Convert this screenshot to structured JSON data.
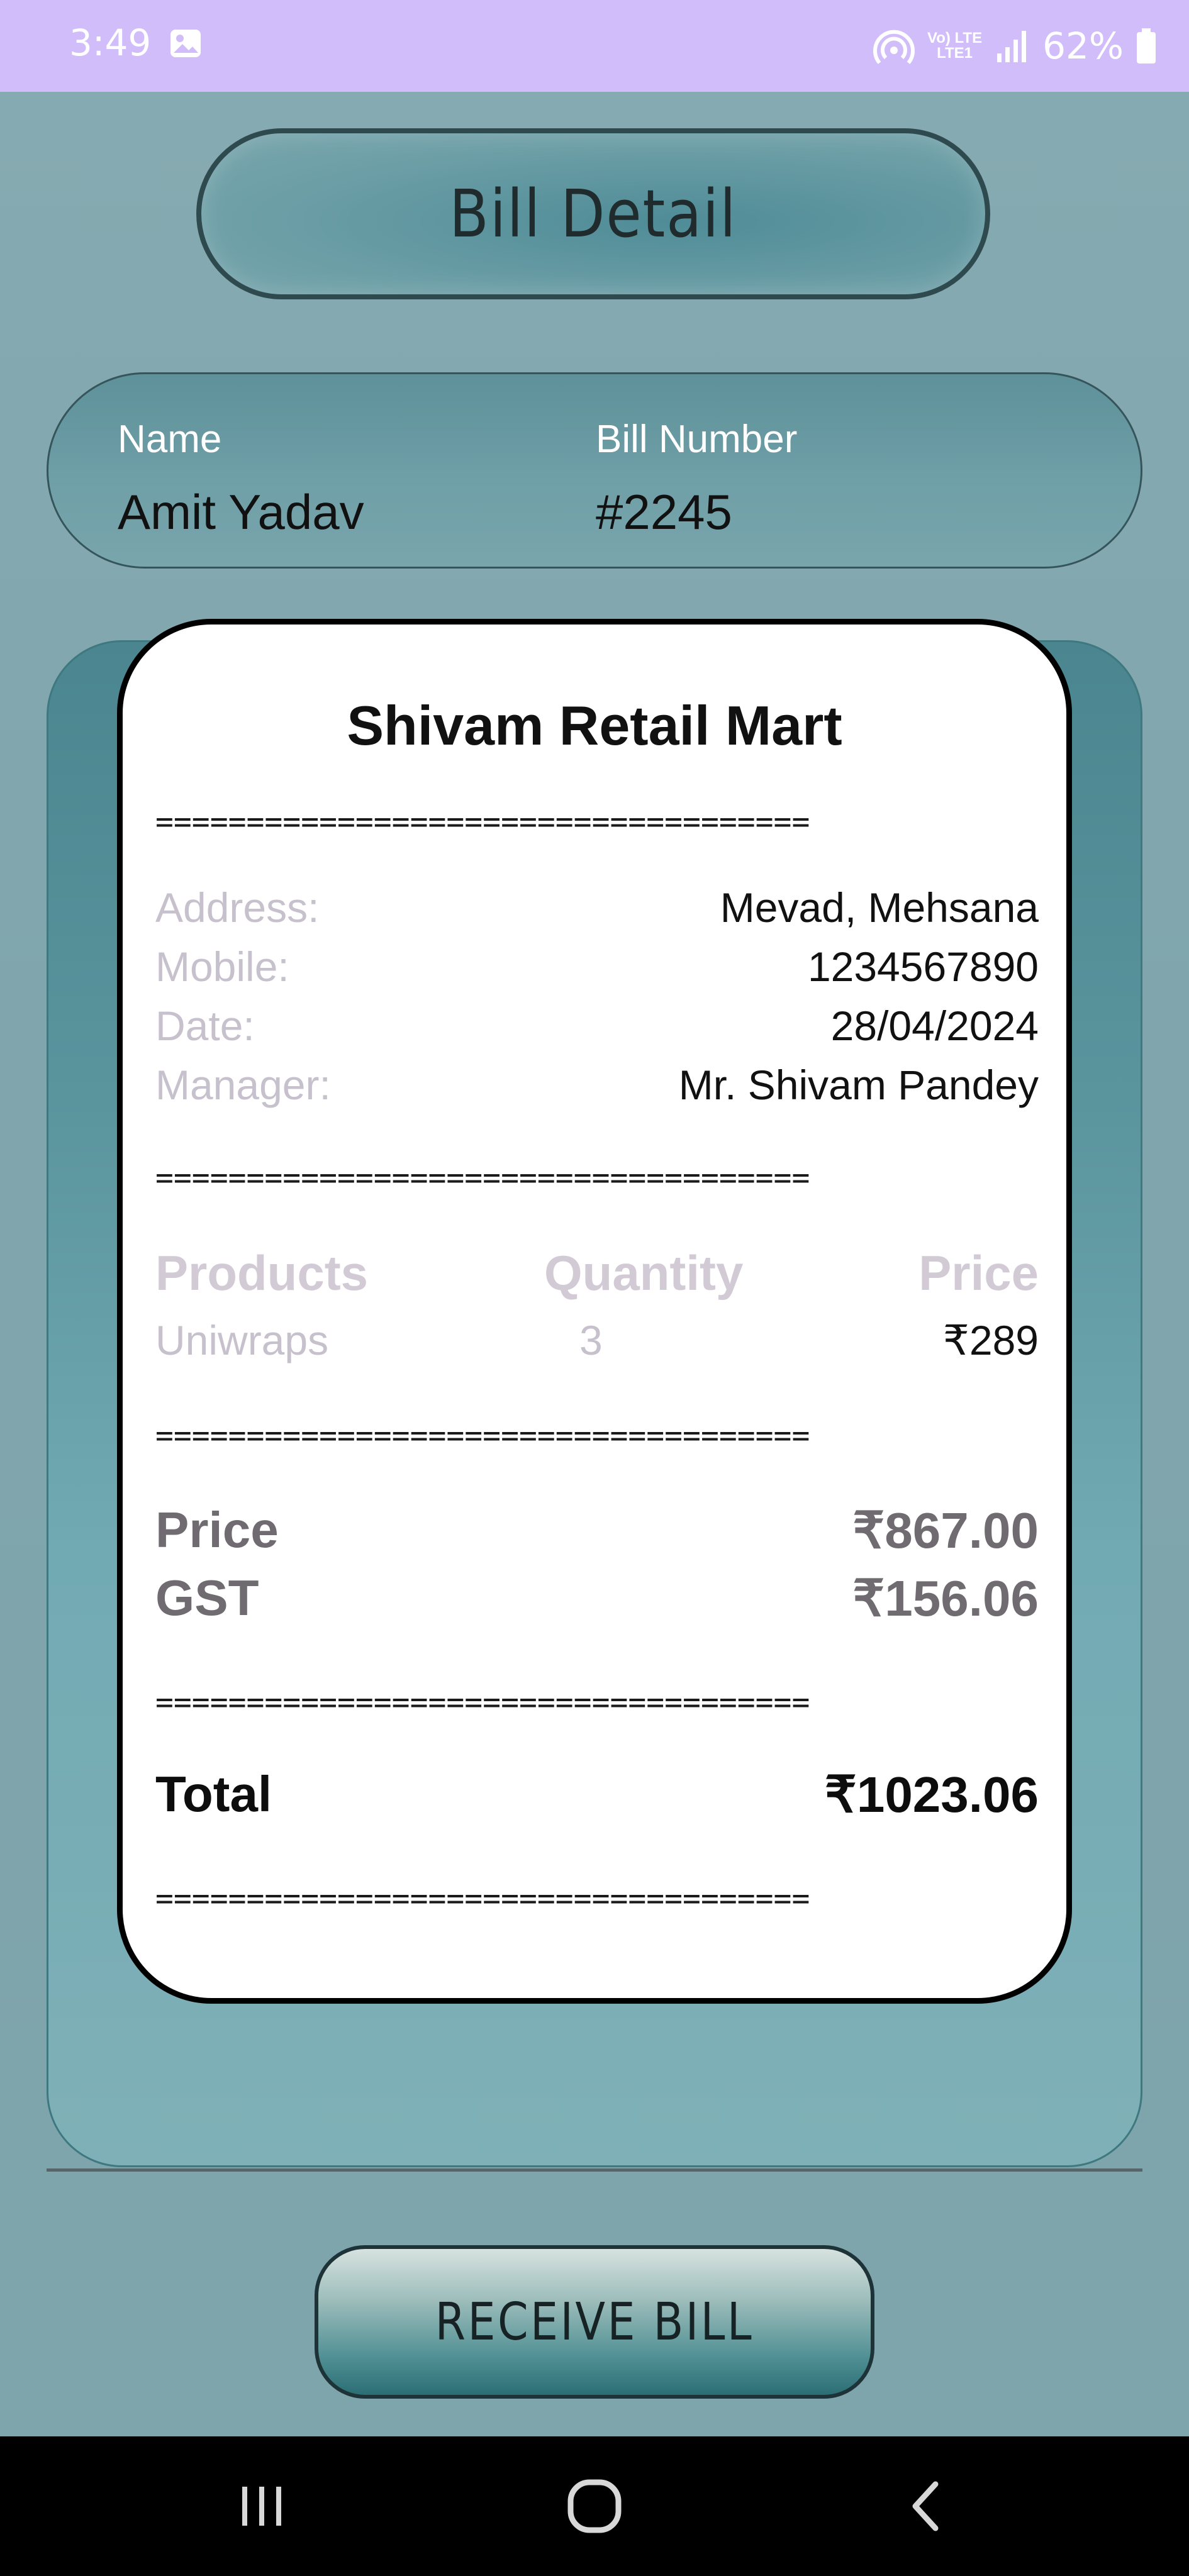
{
  "status_bar": {
    "time": "3:49",
    "network_top": "Vo) LTE",
    "network_bottom": "LTE1",
    "battery": "62%",
    "icons": [
      "gallery-icon",
      "hotspot-icon",
      "signal-icon",
      "battery-icon"
    ]
  },
  "header": {
    "title": "Bill Detail"
  },
  "customer": {
    "name_label": "Name",
    "name_value": "Amit Yadav",
    "bill_number_label": "Bill Number",
    "bill_number_value": "#2245"
  },
  "receipt": {
    "store_name": "Shivam Retail Mart",
    "separator": "====================================",
    "details": [
      {
        "label": "Address:",
        "value": "Mevad, Mehsana"
      },
      {
        "label": "Mobile:",
        "value": "1234567890"
      },
      {
        "label": "Date:",
        "value": "28/04/2024"
      },
      {
        "label": "Manager:",
        "value": "Mr. Shivam Pandey"
      }
    ],
    "table": {
      "headers": [
        "Products",
        "Quantity",
        "Price"
      ],
      "rows": [
        {
          "product": "Uniwraps",
          "quantity": "3",
          "price": "₹289"
        }
      ]
    },
    "price_label": "Price",
    "price_value": "₹867.00",
    "gst_label": "GST",
    "gst_value": "₹156.06",
    "total_label": "Total",
    "total_value": "₹1023.06"
  },
  "actions": {
    "receive_bill": "RECEIVE BILL"
  },
  "nav": {
    "icons": [
      "recent-apps-icon",
      "home-icon",
      "back-icon"
    ]
  },
  "colors": {
    "status_bar": "#d2bdfb",
    "background": "#84a9b0",
    "teal": "#4b8690",
    "receipt_bg": "#ffffff"
  }
}
